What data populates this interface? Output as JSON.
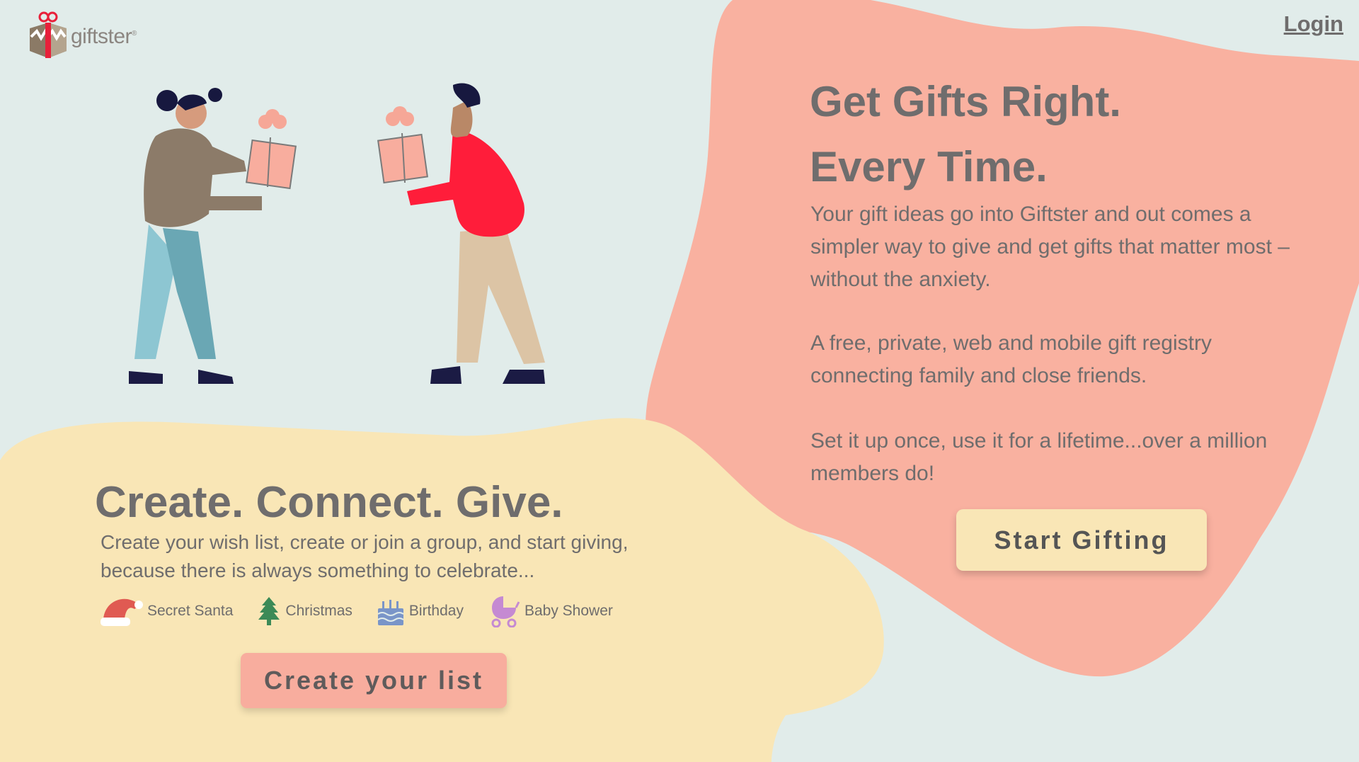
{
  "brand": {
    "name": "giftster",
    "trademark": "®"
  },
  "header": {
    "login_label": "Login"
  },
  "hero": {
    "title_line1": "Get Gifts Right.",
    "title_line2": "Every Time.",
    "paragraph1": "Your gift ideas go into Giftster and out comes a simpler way to give and get gifts that matter most – without the anxiety.",
    "paragraph2": "A free, private, web and mobile gift registry connecting family and close friends.",
    "paragraph3": "Set it up once, use it for a lifetime...over a million members do!",
    "cta_label": "Start Gifting"
  },
  "create_section": {
    "title": "Create. Connect. Give.",
    "paragraph": "Create your wish list, create or join a group, and start giving, because there is always something to celebrate...",
    "occasions": [
      {
        "icon": "santa-hat-icon",
        "label": "Secret Santa"
      },
      {
        "icon": "christmas-tree-icon",
        "label": "Christmas"
      },
      {
        "icon": "birthday-cake-icon",
        "label": "Birthday"
      },
      {
        "icon": "baby-stroller-icon",
        "label": "Baby Shower"
      }
    ],
    "cta_label": "Create your list"
  },
  "colors": {
    "background": "#e1ecea",
    "hero_blob": "#f9b1a0",
    "create_blob": "#f9e6b6",
    "text": "#6f6d6d",
    "accent_red": "#ff1d3a"
  }
}
